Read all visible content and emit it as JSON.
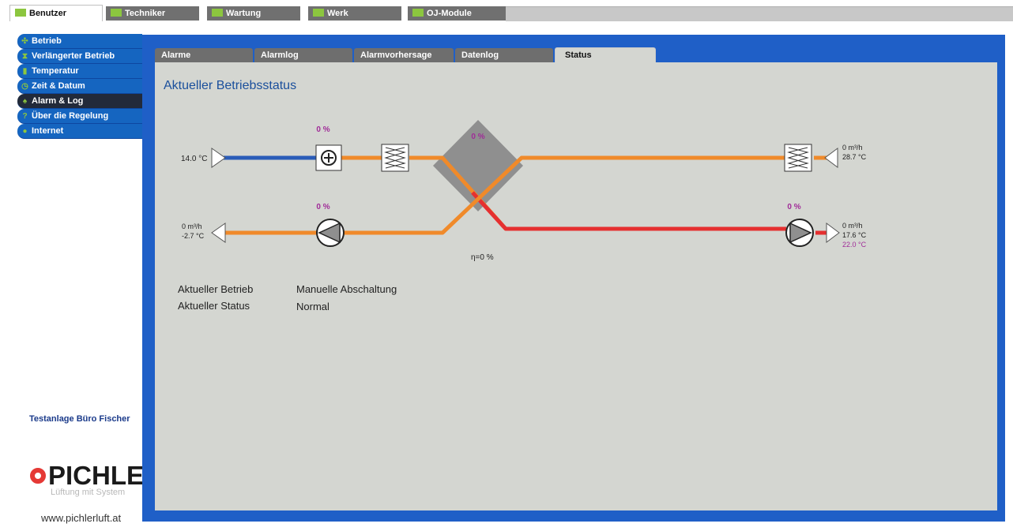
{
  "top_tabs": [
    "Benutzer",
    "Techniker",
    "Wartung",
    "Werk",
    "OJ-Module"
  ],
  "sidebar": {
    "items": [
      "Betrieb",
      "Verlängerter Betrieb",
      "Temperatur",
      "Zeit & Datum",
      "Alarm & Log",
      "Über die Regelung",
      "Internet"
    ]
  },
  "site_name": "Testanlage Büro Fischer",
  "logo": {
    "brand": "PICHLER",
    "slogan": "Lüftung mit System",
    "url": "www.pichlerluft.at"
  },
  "sub_tabs": [
    "Alarme",
    "Alarmlog",
    "Alarmvorhersage",
    "Datenlog",
    "Status"
  ],
  "page_title": "Aktueller Betriebsstatus",
  "diagram": {
    "outdoor_temp": "14.0 °C",
    "heater_pct": "0 %",
    "hx_pct": "0 %",
    "supply_fan_pct": "0 %",
    "exhaust_fan_pct": "0 %",
    "efficiency": "η=0 %",
    "extract_flow": "0 m³/h",
    "extract_temp": "28.7 °C",
    "exhaust_flow": "0 m³/h",
    "exhaust_temp": "-2.7 °C",
    "supply_flow": "0 m³/h",
    "supply_temp": "17.6 °C",
    "supply_setpoint": "22.0 °C",
    "colors": {
      "cold": "#2a5cb8",
      "warm": "#f08a2a",
      "hot": "#e53030",
      "pct": "#a02c98",
      "hx": "#8f8f8f"
    }
  },
  "status": {
    "betrieb_label": "Aktueller Betrieb",
    "betrieb_value": "Manuelle Abschaltung",
    "status_label": "Aktueller Status",
    "status_value": "Normal"
  }
}
